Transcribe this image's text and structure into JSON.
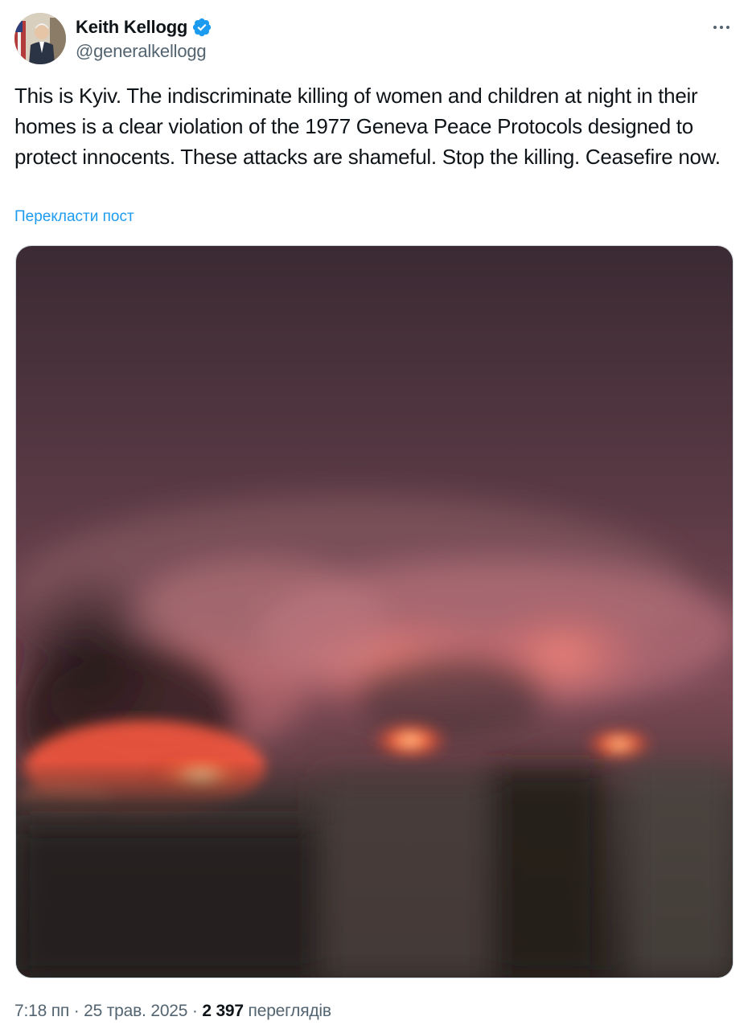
{
  "author": {
    "display_name": "Keith Kellogg",
    "handle": "@generalkellogg",
    "verified": true,
    "verified_badge_color": "#1d9bf0"
  },
  "icons": {
    "more": "more-options-icon",
    "verified": "verified-badge-icon"
  },
  "tweet": {
    "text": "This is Kyiv. The indiscriminate killing of women and children at night in their homes is a clear violation of the 1977 Geneva Peace Protocols designed to protect innocents. These attacks are shameful. Stop the killing. Ceasefire now.",
    "translate_label": "Перекласти пост",
    "media_description": "night sky over city with fires and smoke"
  },
  "meta": {
    "time": "7:18 пп",
    "separator": "·",
    "date": "25 трав. 2025",
    "views_count": "2 397",
    "views_label": "переглядів"
  },
  "colors": {
    "link": "#1d9bf0",
    "secondary_text": "#536471",
    "primary_text": "#0f1419"
  }
}
